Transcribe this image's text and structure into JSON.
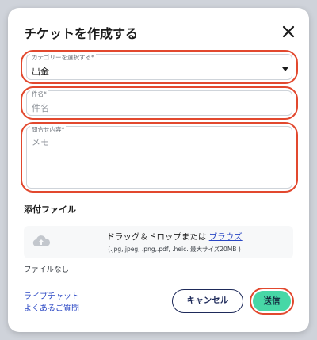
{
  "dialog": {
    "title": "チケットを作成する"
  },
  "category": {
    "label": "カテゴリーを選択する*",
    "value": "出金"
  },
  "subject": {
    "label": "件名*",
    "placeholder": "件名"
  },
  "inquiry": {
    "label": "問合せ内容*",
    "placeholder": "メモ"
  },
  "attachments": {
    "heading": "添付ファイル",
    "drop_text": "ドラッグ＆ドロップまたは",
    "browse_label": "ブラウズ",
    "hint": "(.jpg,.jpeg, .png,.pdf, .heic. 最大サイズ20MB )",
    "no_file": "ファイルなし"
  },
  "footer": {
    "live_chat": "ライブチャット",
    "faq": "よくあるご質問",
    "cancel": "キャンセル",
    "submit": "送信"
  },
  "colors": {
    "highlight": "#e2482e",
    "submit_bg": "#47d7a6",
    "link": "#2a47c4",
    "cancel_border": "#1e2a5a"
  },
  "icons": [
    "close-icon",
    "chevron-down-icon",
    "cloud-upload-icon"
  ]
}
